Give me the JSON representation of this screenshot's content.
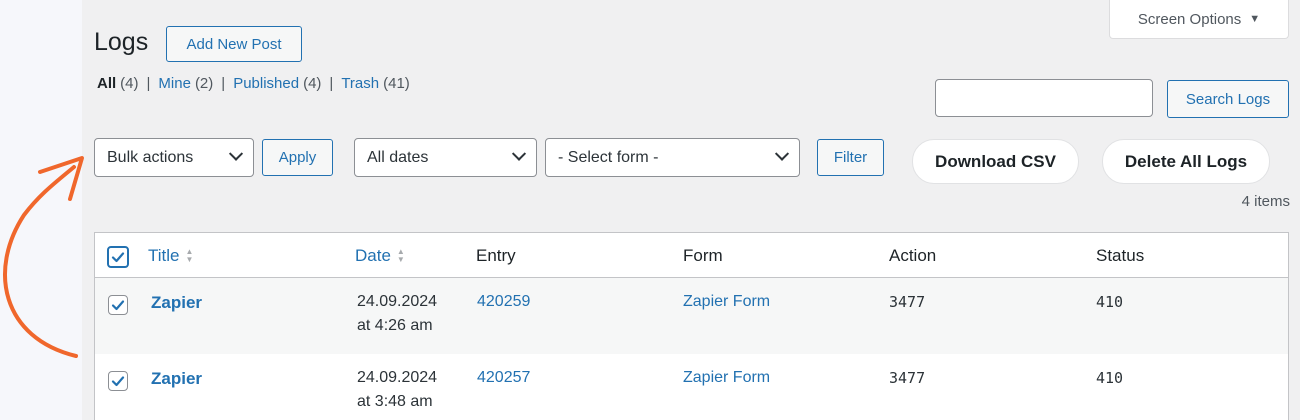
{
  "page": {
    "title": "Logs",
    "add_new_label": "Add New Post",
    "screen_options_label": "Screen Options"
  },
  "views": [
    {
      "label": "All",
      "count": "(4)"
    },
    {
      "label": "Mine",
      "count": "(2)"
    },
    {
      "label": "Published",
      "count": "(4)"
    },
    {
      "label": "Trash",
      "count": "(41)"
    }
  ],
  "separator": "|",
  "search": {
    "value": "",
    "button_label": "Search Logs"
  },
  "toolbar": {
    "bulk_actions": "Bulk actions",
    "apply_label": "Apply",
    "dates": "All dates",
    "form_select": "- Select form -",
    "filter_label": "Filter",
    "download_label": "Download CSV",
    "delete_all_label": "Delete All Logs",
    "items_count": "4 items"
  },
  "table": {
    "columns": [
      "Title",
      "Date",
      "Entry",
      "Form",
      "Action",
      "Status"
    ],
    "rows": [
      {
        "title": "Zapier",
        "date_line1": "24.09.2024",
        "date_line2": "at 4:26 am",
        "entry": "420259",
        "form": "Zapier Form",
        "action": "3477",
        "status": "410",
        "checked": true
      },
      {
        "title": "Zapier",
        "date_line1": "24.09.2024",
        "date_line2": "at 3:48 am",
        "entry": "420257",
        "form": "Zapier Form",
        "action": "3477",
        "status": "410",
        "checked": true
      }
    ]
  },
  "colors": {
    "accent": "#2271b1",
    "annotation_arrow": "#f0672c",
    "background": "#f0f0f1"
  },
  "icons": [
    "screen-options-triangle",
    "chevron-down-icon",
    "sort-arrows-icon",
    "checkmark-icon",
    "annotation-arrow"
  ]
}
